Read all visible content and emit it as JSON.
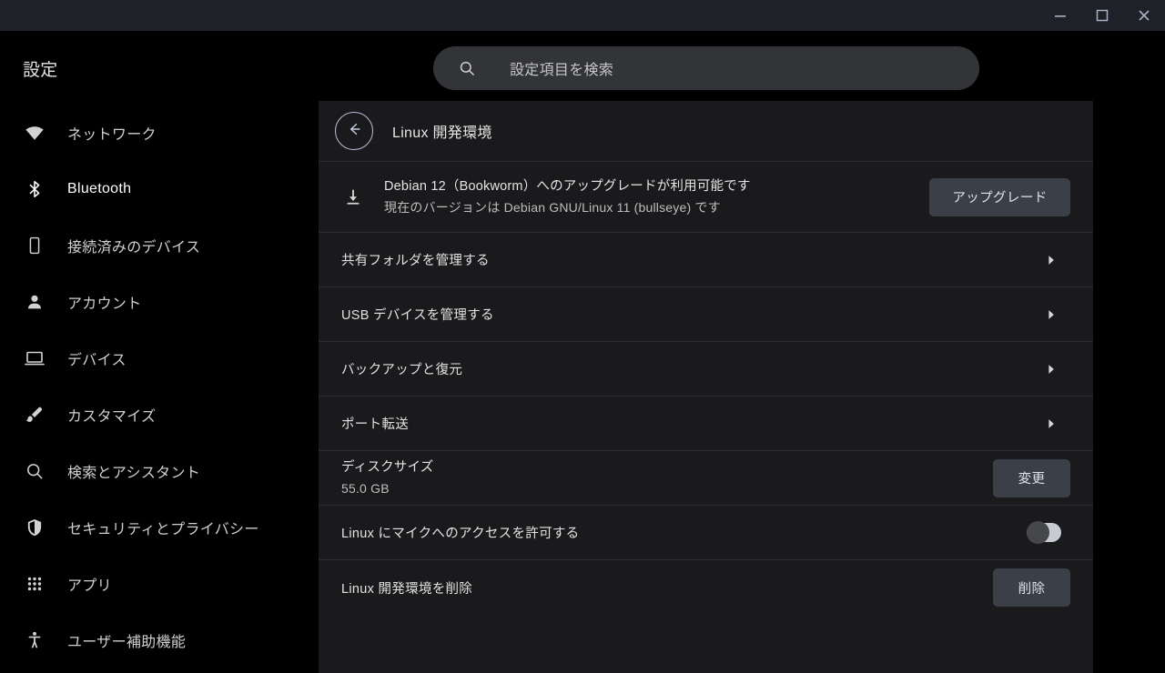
{
  "window": {
    "controls": [
      {
        "name": "minimize",
        "glyph": "minimize-icon"
      },
      {
        "name": "maximize",
        "glyph": "maximize-icon"
      },
      {
        "name": "close",
        "glyph": "close-icon"
      }
    ]
  },
  "app": {
    "title": "設定"
  },
  "search": {
    "placeholder": "設定項目を検索",
    "icon": "search-icon",
    "value": ""
  },
  "sidebar": {
    "items": [
      {
        "label": "ネットワーク",
        "icon": "wifi-icon",
        "selected": false
      },
      {
        "label": "Bluetooth",
        "icon": "bluetooth-icon",
        "selected": true
      },
      {
        "label": "接続済みのデバイス",
        "icon": "phone-icon",
        "selected": false
      },
      {
        "label": "アカウント",
        "icon": "person-icon",
        "selected": false
      },
      {
        "label": "デバイス",
        "icon": "laptop-icon",
        "selected": false
      },
      {
        "label": "カスタマイズ",
        "icon": "brush-icon",
        "selected": false
      },
      {
        "label": "検索とアシスタント",
        "icon": "search-icon",
        "selected": false
      },
      {
        "label": "セキュリティとプライバシー",
        "icon": "shield-icon",
        "selected": false
      },
      {
        "label": "アプリ",
        "icon": "apps-grid-icon",
        "selected": false
      },
      {
        "label": "ユーザー補助機能",
        "icon": "accessibility-icon",
        "selected": false
      }
    ]
  },
  "page": {
    "title": "Linux 開発環境",
    "back_icon": "arrow-left-icon",
    "upgrade": {
      "icon": "download-icon",
      "primary": "Debian 12（Bookworm）へのアップグレードが利用可能です",
      "secondary": "現在のバージョンは Debian GNU/Linux 11 (bullseye) です",
      "button_label": "アップグレード"
    },
    "nav_rows": [
      {
        "label": "共有フォルダを管理する",
        "icon": "chevron-right-icon"
      },
      {
        "label": "USB デバイスを管理する",
        "icon": "chevron-right-icon"
      },
      {
        "label": "バックアップと復元",
        "icon": "chevron-right-icon"
      },
      {
        "label": "ポート転送",
        "icon": "chevron-right-icon"
      }
    ],
    "disk": {
      "label": "ディスクサイズ",
      "value": "55.0 GB",
      "button_label": "変更"
    },
    "microphone": {
      "label": "Linux にマイクへのアクセスを許可する",
      "enabled": false
    },
    "remove": {
      "label": "Linux 開発環境を削除",
      "button_label": "削除"
    }
  },
  "colors": {
    "titlebar": "#1f2128",
    "sidebar_bg": "#000000",
    "panel_bg": "#1a1a1c",
    "search_bg": "#333438",
    "button_bg": "#3b3f48",
    "divider": "#2c2c2e",
    "back_ring": "#b8c0d8",
    "toggle_track": "#c7ccd3",
    "toggle_knob": "#464749"
  }
}
